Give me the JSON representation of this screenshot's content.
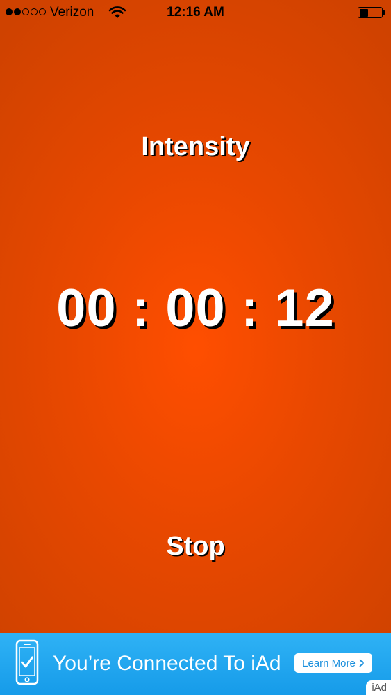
{
  "status_bar": {
    "carrier": "Verizon",
    "signal_bars_filled": 2,
    "signal_bars_total": 5,
    "time": "12:16 AM",
    "battery_level": 0.4,
    "wifi_icon": "wifi-icon",
    "battery_icon": "battery-icon"
  },
  "main": {
    "title": "Intensity",
    "timer": "00 : 00 : 12",
    "stop_label": "Stop",
    "background_color": "#ff4e00"
  },
  "ad": {
    "icon": "phone-check-icon",
    "message": "You’re Connected To iAd",
    "cta_label": "Learn More",
    "cta_icon": "chevron-right-icon",
    "tag": "iAd",
    "background_color": "#1a9eea"
  }
}
